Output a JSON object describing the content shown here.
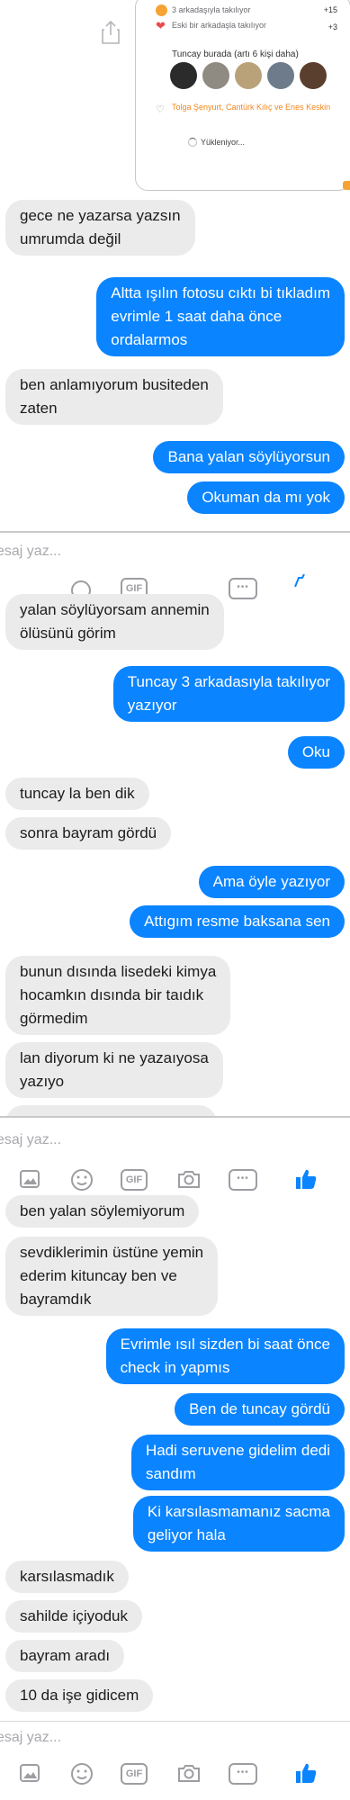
{
  "share_card": {
    "rows": [
      {
        "text": "3 arkadaşıyla takılıyor",
        "count": "+15"
      },
      {
        "text": "Eski bir arkadaşla takılıyor",
        "count": "+3"
      }
    ],
    "title": "Tuncay burada (artı 6 kişi daha)",
    "link_text": "Tolga Şenyurt, Cantürk Kılıç ve Enes Keskin",
    "loading": "Yükleniyor..."
  },
  "panel1_messages": [
    {
      "side": "in",
      "text": "gece ne yazarsa yazsın\numrumda değil"
    },
    {
      "side": "out",
      "text": "Altta ışılın fotosu cıktı bi tıkladım\nevrimle 1 saat daha önce\nordalarmos"
    },
    {
      "side": "in",
      "text": "ben anlamıyorum busiteden\nzaten"
    },
    {
      "side": "out",
      "text": "Bana yalan söylüyorsun"
    },
    {
      "side": "out",
      "text": "Okuman da mı yok"
    }
  ],
  "composer": {
    "placeholder": "esaj yaz...",
    "gif_label": "GIF",
    "more_label": "•••"
  },
  "panel2_messages": [
    {
      "side": "in",
      "text": "yalan söylüyorsam annemin\nölüsünü görim"
    },
    {
      "side": "out",
      "text": "Tuncay 3 arkadasıyla takılıyor\nyazıyor"
    },
    {
      "side": "out",
      "text": "Oku"
    },
    {
      "side": "in",
      "text": "tuncay la ben dik"
    },
    {
      "side": "in",
      "text": "sonra bayram gördü"
    },
    {
      "side": "out",
      "text": "Ama öyle yazıyor"
    },
    {
      "side": "out",
      "text": "Attıgım resme baksana sen"
    },
    {
      "side": "in",
      "text": "bunun dısında lisedeki kimya\nhocamkın dısında bir taıdık\ngörmedim"
    },
    {
      "side": "in",
      "text": "lan diyorum ki ne yazaıyosa\nyazıyo"
    }
  ],
  "panel3_messages": [
    {
      "side": "in",
      "text": "ben yalan söylemiyorum"
    },
    {
      "side": "in",
      "text": "sevdiklerimin üstüne yemin\nederim kituncay ben ve\nbayramdık"
    },
    {
      "side": "out",
      "text": "Evrimle ısıl sizden bi saat önce\ncheck in yapmıs"
    },
    {
      "side": "out",
      "text": "Ben de tuncay gördü"
    },
    {
      "side": "out",
      "text": "Hadi seruvene gidelim dedi\nsandım"
    },
    {
      "side": "out",
      "text": "Ki karsılasmamanız sacma\ngeliyor hala"
    },
    {
      "side": "in",
      "text": "karsılasmadık"
    },
    {
      "side": "in",
      "text": "sahilde içiyoduk"
    },
    {
      "side": "in",
      "text": "bayram aradı"
    },
    {
      "side": "in",
      "text": "10 da işe gidicem"
    }
  ],
  "colors": {
    "outgoing": "#0a84ff",
    "incoming": "#ebebeb",
    "like": "#0a84ff",
    "accent": "#f7a233"
  }
}
